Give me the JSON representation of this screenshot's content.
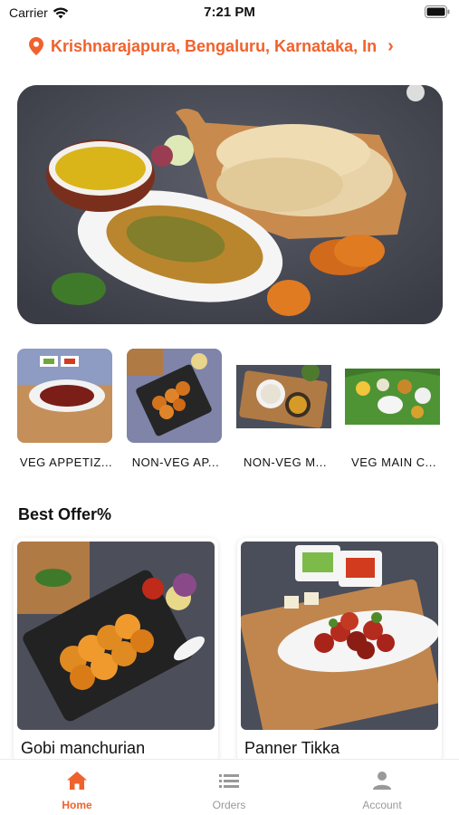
{
  "status": {
    "carrier": "Carrier",
    "time": "7:21 PM"
  },
  "location": {
    "address": "Krishnarajapura, Bengaluru, Karnataka, In"
  },
  "categories": [
    {
      "label": "VEG APPETIZ..."
    },
    {
      "label": "NON-VEG AP..."
    },
    {
      "label": "NON-VEG M..."
    },
    {
      "label": "VEG MAIN C..."
    }
  ],
  "offers": {
    "title": "Best Offer%",
    "items": [
      {
        "name": "Gobi manchurian"
      },
      {
        "name": "Panner Tikka"
      }
    ]
  },
  "tabs": [
    {
      "label": "Home",
      "icon": "home-icon"
    },
    {
      "label": "Orders",
      "icon": "list-icon"
    },
    {
      "label": "Account",
      "icon": "person-icon"
    }
  ],
  "colors": {
    "accent": "#f0622d",
    "inactive": "#999999"
  }
}
